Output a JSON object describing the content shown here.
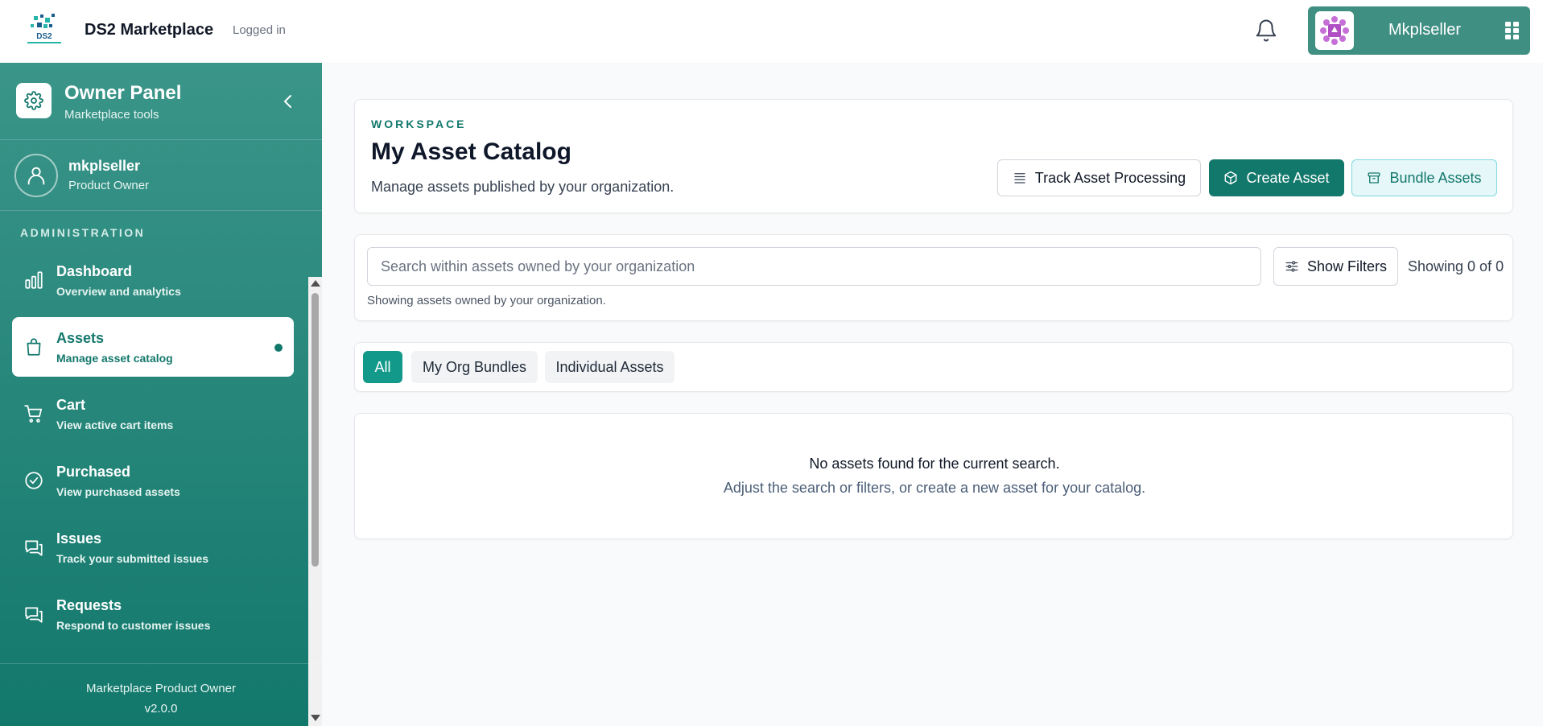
{
  "header": {
    "brand": "DS2 Marketplace",
    "login_status": "Logged in",
    "logo_text": "DS2",
    "user_name": "Mkplseller"
  },
  "sidebar": {
    "panel_title": "Owner Panel",
    "panel_subtitle": "Marketplace tools",
    "profile": {
      "name": "mkplseller",
      "role": "Product Owner"
    },
    "section_label": "ADMINISTRATION",
    "items": [
      {
        "label": "Dashboard",
        "sub": "Overview and analytics",
        "icon": "bar-chart-icon",
        "active": false
      },
      {
        "label": "Assets",
        "sub": "Manage asset catalog",
        "icon": "shopping-bag-icon",
        "active": true
      },
      {
        "label": "Cart",
        "sub": "View active cart items",
        "icon": "cart-icon",
        "active": false
      },
      {
        "label": "Purchased",
        "sub": "View purchased assets",
        "icon": "check-circle-icon",
        "active": false
      },
      {
        "label": "Issues",
        "sub": "Track your submitted issues",
        "icon": "chat-icon",
        "active": false
      },
      {
        "label": "Requests",
        "sub": "Respond to customer issues",
        "icon": "chat-icon",
        "active": false
      }
    ],
    "footer_role": "Marketplace Product Owner",
    "footer_version": "v2.0.0"
  },
  "workspace": {
    "eyebrow": "WORKSPACE",
    "title": "My Asset Catalog",
    "description": "Manage assets published by your organization.",
    "track_label": "Track Asset Processing",
    "create_label": "Create Asset",
    "bundle_label": "Bundle Assets"
  },
  "search": {
    "placeholder": "Search within assets owned by your organization",
    "value": "",
    "filters_label": "Show Filters",
    "count": "Showing 0 of 0",
    "note": "Showing assets owned by your organization."
  },
  "tabs": [
    {
      "label": "All",
      "active": true
    },
    {
      "label": "My Org Bundles",
      "active": false
    },
    {
      "label": "Individual Assets",
      "active": false
    }
  ],
  "empty": {
    "title": "No assets found for the current search.",
    "subtitle": "Adjust the search or filters, or create a new asset for your catalog."
  },
  "colors": {
    "primary": "#13786c",
    "sidebar_top": "#3b9589",
    "accent_light": "#e6f7f9",
    "user_box": "#3f8f83"
  }
}
